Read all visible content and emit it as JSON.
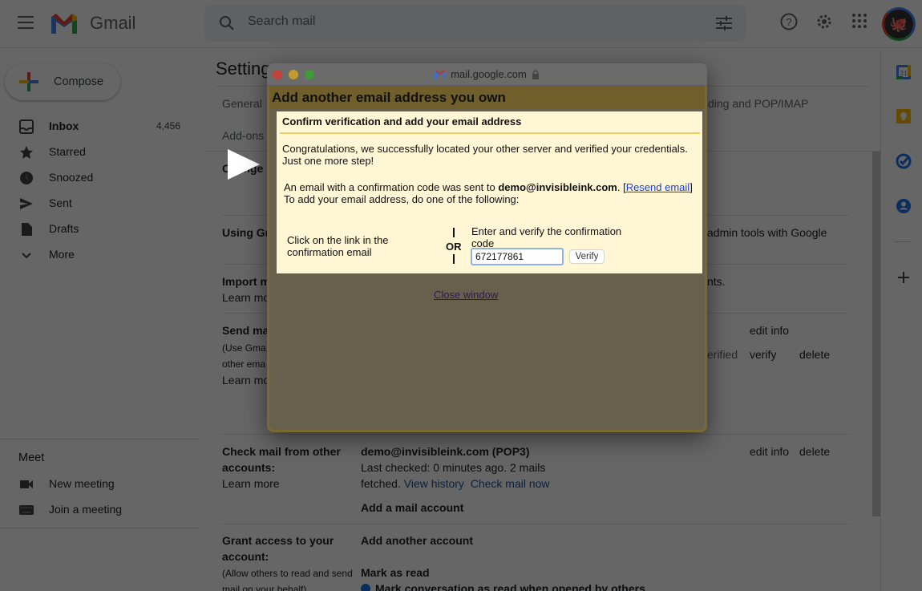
{
  "app": {
    "name": "Gmail",
    "search_placeholder": "Search mail"
  },
  "sidebar": {
    "compose_label": "Compose",
    "items": [
      {
        "label": "Inbox",
        "count": "4,456",
        "icon": "inbox-icon"
      },
      {
        "label": "Starred",
        "icon": "star-icon"
      },
      {
        "label": "Snoozed",
        "icon": "clock-icon"
      },
      {
        "label": "Sent",
        "icon": "send-icon"
      },
      {
        "label": "Drafts",
        "icon": "draft-icon"
      },
      {
        "label": "More",
        "icon": "chevron-down-icon"
      }
    ],
    "meet": {
      "title": "Meet",
      "items": [
        {
          "label": "New meeting",
          "icon": "video-icon"
        },
        {
          "label": "Join a meeting",
          "icon": "keyboard-icon"
        }
      ]
    }
  },
  "main": {
    "title": "Settings",
    "tabs": [
      "General",
      "Add-ons",
      "ding and POP/IMAP"
    ],
    "rows": {
      "change_account": "Change a",
      "using_gmail": "Using Gr",
      "using_gmail_tail": "admin tools with Google",
      "import": "Import m",
      "import_learn": "Learn mo",
      "import_tail": "nts.",
      "send_mail": "Send ma",
      "send_sub1": "(Use Gma",
      "send_sub2": "other ema",
      "send_learn": "Learn mo",
      "send_edit_info": "edit info",
      "send_verified": "erified",
      "send_verify": "verify",
      "send_delete": "delete",
      "check_mail_label_1": "Check mail from other",
      "check_mail_label_2": "accounts:",
      "check_mail_learn": "Learn more",
      "check_mail_account": "demo@invisibleink.com (POP3)",
      "check_mail_status_1": "Last checked: 0 minutes ago. 2 mails",
      "check_mail_status_2": "fetched.",
      "view_history": "View history",
      "check_mail_now": "Check mail now",
      "add_mail_account": "Add a mail account",
      "check_edit_info": "edit info",
      "check_delete": "delete",
      "grant_label_1": "Grant access to your",
      "grant_label_2": "account:",
      "grant_sub_1": "(Allow others to read and send",
      "grant_sub_2": "mail on your behalf)",
      "add_another_account": "Add another account",
      "mark_as_read": "Mark as read",
      "mark_conversation": "Mark conversation as read when opened by others"
    }
  },
  "dialog": {
    "url": "mail.google.com",
    "title": "Add another email address you own",
    "panel_title": "Confirm verification and add your email address",
    "congrats_1": "Congratulations, we successfully located your other server and verified your credentials.",
    "congrats_2": "Just one more step!",
    "sent_prefix": "An email with a confirmation code was sent to ",
    "sent_email": "demo@invisibleink.com",
    "sent_suffix": ". [",
    "resend_link": "Resend email",
    "sent_close": "]",
    "instructions": "To add your email address, do one of the following:",
    "option_link_1": "Click on the link in the",
    "option_link_2": "confirmation email",
    "or_label": "OR",
    "option_code_1": "Enter and verify the confirmation",
    "option_code_2": "code",
    "code_value": "672177861",
    "verify_button": "Verify",
    "close_window": "Close window"
  },
  "colors": {
    "panel_bg": "#fff6d6",
    "dialog_header": "#c9a640",
    "link": "#1a3fd6"
  }
}
